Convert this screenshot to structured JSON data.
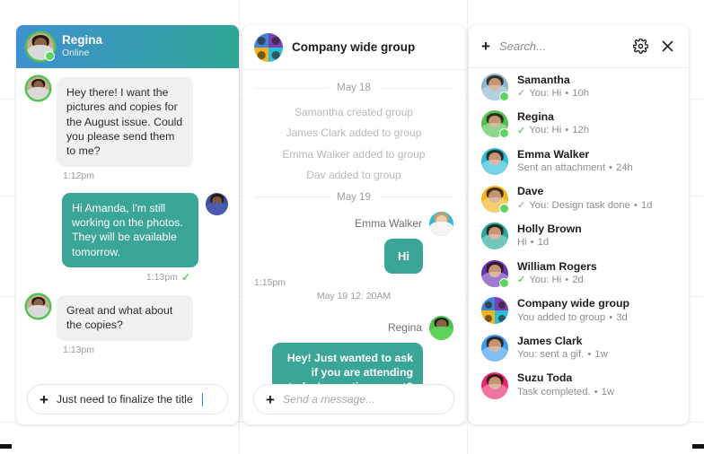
{
  "left_panel": {
    "header": {
      "name": "Regina",
      "status": "Online",
      "avatar_color": "#6a4a3a",
      "ring": "#4fc24f",
      "online": true
    },
    "messages": [
      {
        "dir": "in",
        "text": "Hey there! I want the pictures and copies for the August issue. Could you please send them to me?",
        "time": "1:12pm",
        "avatar_color": "#6a4a3a",
        "ring": "#4fc24f",
        "tick": null
      },
      {
        "dir": "out",
        "text": "Hi Amanda, I'm still working on the photos. They will be available tomorrow.",
        "time": "1:13pm",
        "avatar_color": "#3f4fa0",
        "ring": null,
        "tick": "green"
      },
      {
        "dir": "in",
        "text": "Great and what about the copies?",
        "time": "1:13pm",
        "avatar_color": "#6a4a3a",
        "ring": "#4fc24f",
        "tick": null
      }
    ],
    "composer": {
      "plus_icon": "plus-icon",
      "value": "Just need to finalize the title",
      "placeholder": "",
      "caret_color": "#4285f4"
    }
  },
  "middle_panel": {
    "header": {
      "title": "Company wide group",
      "avatar_type": "group-quad",
      "quad_colors": [
        "#3e86d6",
        "#7b3fb3",
        "#f2b41c",
        "#2fbcd6"
      ]
    },
    "groups": [
      {
        "date": "May 18",
        "system_lines": [
          "Samantha created group",
          "James Clark added to group",
          "Emma Walker added to group",
          "Dav added to group"
        ],
        "messages": []
      },
      {
        "date": "May 19",
        "system_lines": [],
        "messages": [
          {
            "sender": "Emma Walker",
            "text": "Hi",
            "time": "1:15pm",
            "time2": "May 19 12: 20AM",
            "avatar_color": "#2fbcd6"
          },
          {
            "sender": "Regina",
            "text": "Hey! Just wanted to ask if you are attending today's meeting or not?",
            "time": "",
            "time2": "",
            "avatar_color": "#4fc24f"
          }
        ]
      }
    ],
    "composer": {
      "plus_icon": "plus-icon",
      "value": "",
      "placeholder": "Send a message..."
    }
  },
  "right_panel": {
    "search": {
      "plus_icon": "plus-icon",
      "placeholder": "Search...",
      "settings_icon": "gear-icon",
      "close_icon": "close-icon"
    },
    "contacts": [
      {
        "name": "Samantha",
        "tick": "grey",
        "preview": "You: Hi",
        "time": "10h",
        "avatar_color": "#8fb6cf",
        "online": true,
        "type": "person"
      },
      {
        "name": "Regina",
        "tick": "green",
        "preview": "You: Hi",
        "time": "12h",
        "avatar_color": "#4fc24f",
        "online": true,
        "type": "person"
      },
      {
        "name": "Emma Walker",
        "tick": null,
        "preview": "Sent an attachment",
        "time": "24h",
        "avatar_color": "#2fbcd6",
        "online": false,
        "type": "person"
      },
      {
        "name": "Dave",
        "tick": "grey",
        "preview": "You: Design task done",
        "time": "1d",
        "avatar_color": "#f2b41c",
        "online": true,
        "type": "person"
      },
      {
        "name": "Holly Brown",
        "tick": null,
        "preview": "Hi",
        "time": "1d",
        "avatar_color": "#27a898",
        "online": false,
        "type": "person"
      },
      {
        "name": "William Rogers",
        "tick": "green",
        "preview": "You: Hi",
        "time": "2d",
        "avatar_color": "#6a35b5",
        "online": true,
        "type": "person"
      },
      {
        "name": "Company wide group",
        "tick": null,
        "preview": "You added to group",
        "time": "3d",
        "avatar_color": "#3e86d6",
        "online": false,
        "type": "group"
      },
      {
        "name": "James Clark",
        "tick": null,
        "preview": "You: sent a gif.",
        "time": "1w",
        "avatar_color": "#3e9bee",
        "online": false,
        "type": "person"
      },
      {
        "name": "Suzu Toda",
        "tick": null,
        "preview": "Task completed.",
        "time": "1w",
        "avatar_color": "#ea2a6e",
        "online": false,
        "type": "person"
      }
    ]
  },
  "theme": {
    "accent_teal": "#3ba697",
    "header_blue": "#3f8fd1",
    "online_green": "#5ed35e",
    "bubble_grey": "#f1f1f1"
  }
}
